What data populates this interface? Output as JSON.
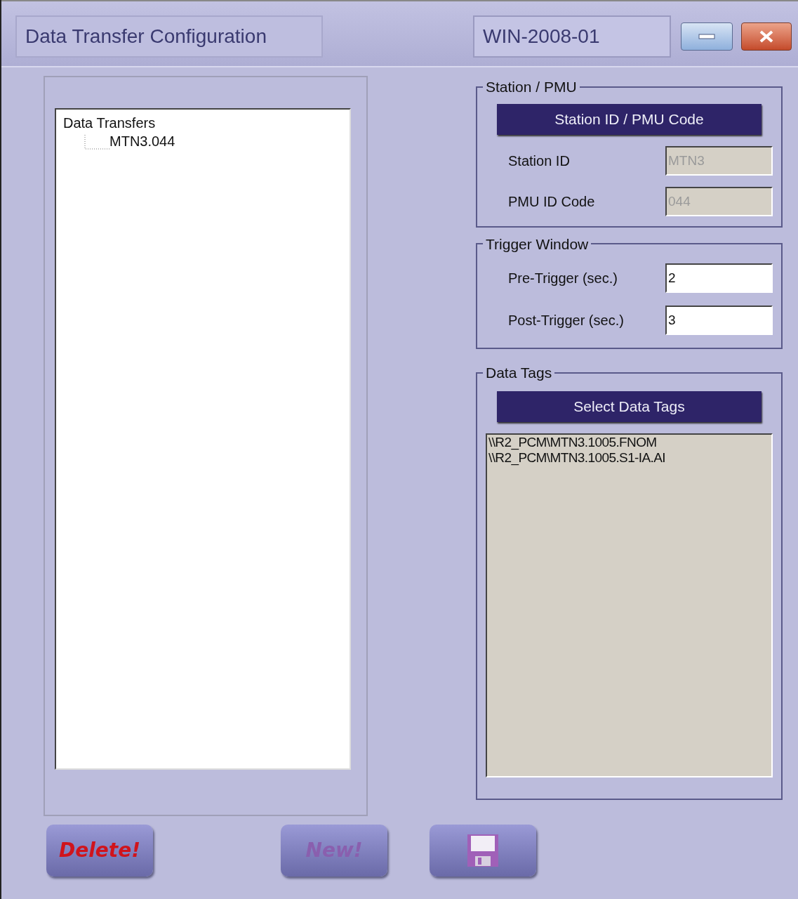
{
  "window": {
    "title": "Data Transfer Configuration",
    "host": "WIN-2008-01"
  },
  "tree": {
    "label": "Data Transfers",
    "children": [
      {
        "label": "MTN3.044"
      }
    ]
  },
  "station_pmu": {
    "title": "Station / PMU",
    "button": "Station ID / PMU Code",
    "fields": [
      {
        "label": "Station ID",
        "value": "MTN3",
        "disabled": true
      },
      {
        "label": "PMU ID Code",
        "value": "044",
        "disabled": true
      }
    ]
  },
  "trigger_window": {
    "title": "Trigger Window",
    "fields": [
      {
        "label": "Pre-Trigger (sec.)",
        "value": "2",
        "disabled": false
      },
      {
        "label": "Post-Trigger (sec.)",
        "value": "3",
        "disabled": false
      }
    ]
  },
  "data_tags": {
    "title": "Data Tags",
    "button": "Select Data Tags",
    "items": [
      "\\\\R2_PCM\\MTN3.1005.FNOM",
      "\\\\R2_PCM\\MTN3.1005.S1-IA.AI"
    ]
  },
  "buttons": [
    {
      "kind": "delete",
      "label": "Delete!",
      "disabled": false
    },
    {
      "kind": "new",
      "label": "New!",
      "disabled": true
    },
    {
      "kind": "save",
      "disabled": false
    }
  ]
}
